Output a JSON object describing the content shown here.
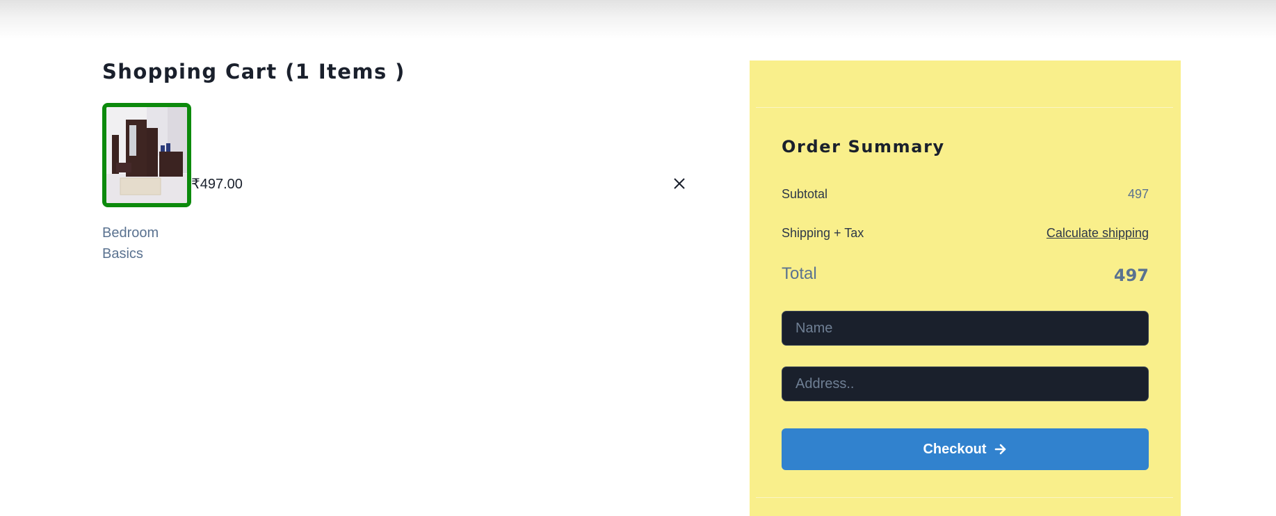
{
  "cart": {
    "title": "Shopping Cart (1 Items )",
    "items": [
      {
        "name": "Bedroom Basics",
        "price": "₹497.00",
        "image_icon": "bedroom-furniture-photo",
        "remove_icon": "close-icon"
      }
    ]
  },
  "summary": {
    "title": "Order Summary",
    "subtotal_label": "Subtotal",
    "subtotal_value": "497",
    "shipping_label": "Shipping + Tax",
    "shipping_link": "Calculate shipping",
    "total_label": "Total",
    "total_value": "497",
    "name_placeholder": "Name",
    "address_placeholder": "Address..",
    "checkout_label": "Checkout",
    "checkout_icon": "arrow-right-icon"
  },
  "colors": {
    "summary_bg": "#f9ef8b",
    "thumb_border": "#0c8a0c",
    "checkout_bg": "#3182ce",
    "input_bg": "#1a202c",
    "muted_text": "#5a7290"
  }
}
